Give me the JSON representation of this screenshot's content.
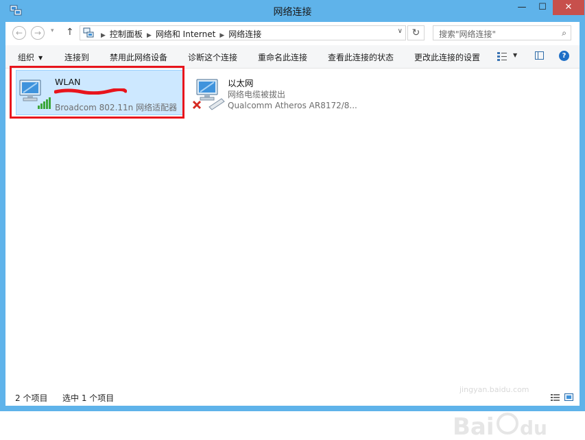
{
  "window": {
    "title": "网络连接",
    "min_glyph": "—",
    "max_glyph": "☐",
    "close_glyph": "✕"
  },
  "nav": {
    "back_glyph": "←",
    "forward_glyph": "→",
    "recent_glyph": "▾",
    "up_glyph": "↑",
    "breadcrumbs": [
      "控制面板",
      "网络和 Internet",
      "网络连接"
    ],
    "separator_glyph": "▶",
    "dropdown_glyph": "∨",
    "refresh_glyph": "↻",
    "search_placeholder": "搜索\"网络连接\"",
    "search_glyph": "⌕"
  },
  "toolbar": {
    "organize": "组织",
    "connect_to": "连接到",
    "disable": "禁用此网络设备",
    "diagnose": "诊断这个连接",
    "rename": "重命名此连接",
    "view_status": "查看此连接的状态",
    "change_settings": "更改此连接的设置",
    "caret_glyph": "▼",
    "help_glyph": "?"
  },
  "connections": [
    {
      "name": "WLAN",
      "status": "",
      "device": "Broadcom 802.11n 网络适配器",
      "icon": "wifi-adapter-icon",
      "selected": true
    },
    {
      "name": "以太网",
      "status": "网络电缆被拔出",
      "device": "Qualcomm Atheros AR8172/8...",
      "icon": "ethernet-adapter-icon",
      "selected": false
    }
  ],
  "statusbar": {
    "count": "2 个项目",
    "selected": "选中 1 个项目"
  },
  "watermark": {
    "url": "jingyan.baidu.com"
  },
  "colors": {
    "titlebar": "#5fb3ea",
    "close_button": "#c7504c",
    "selection_bg": "#cde8ff",
    "highlight_box": "#e8141c"
  }
}
